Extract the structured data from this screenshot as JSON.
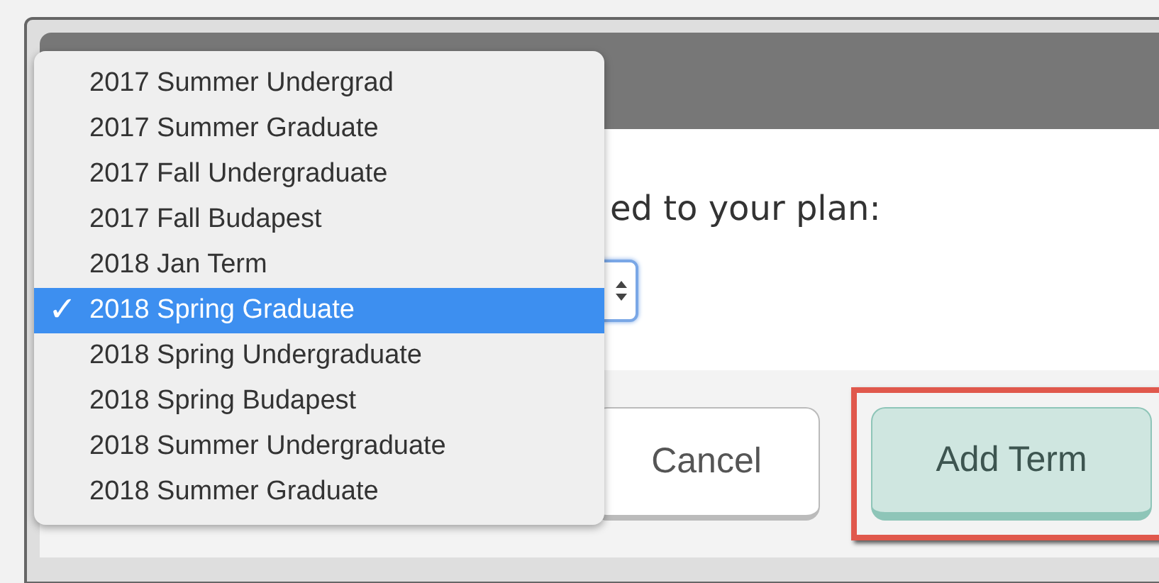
{
  "dialog": {
    "prompt": "ed to your plan:"
  },
  "term_menu": {
    "items": [
      {
        "label": "2017 Summer Undergrad",
        "selected": false
      },
      {
        "label": "2017 Summer Graduate",
        "selected": false
      },
      {
        "label": "2017 Fall Undergraduate",
        "selected": false
      },
      {
        "label": "2017 Fall Budapest",
        "selected": false
      },
      {
        "label": "2018 Jan Term",
        "selected": false
      },
      {
        "label": "2018 Spring Graduate",
        "selected": true
      },
      {
        "label": "2018 Spring Undergraduate",
        "selected": false
      },
      {
        "label": "2018 Spring Budapest",
        "selected": false
      },
      {
        "label": "2018 Summer Undergraduate",
        "selected": false
      },
      {
        "label": "2018 Summer Graduate",
        "selected": false
      }
    ]
  },
  "check_mark": "✓",
  "buttons": [
    {
      "kind": "secondary",
      "label": "Cancel",
      "highlighted": false
    },
    {
      "kind": "primary",
      "label": "Add Term",
      "highlighted": true
    }
  ]
}
